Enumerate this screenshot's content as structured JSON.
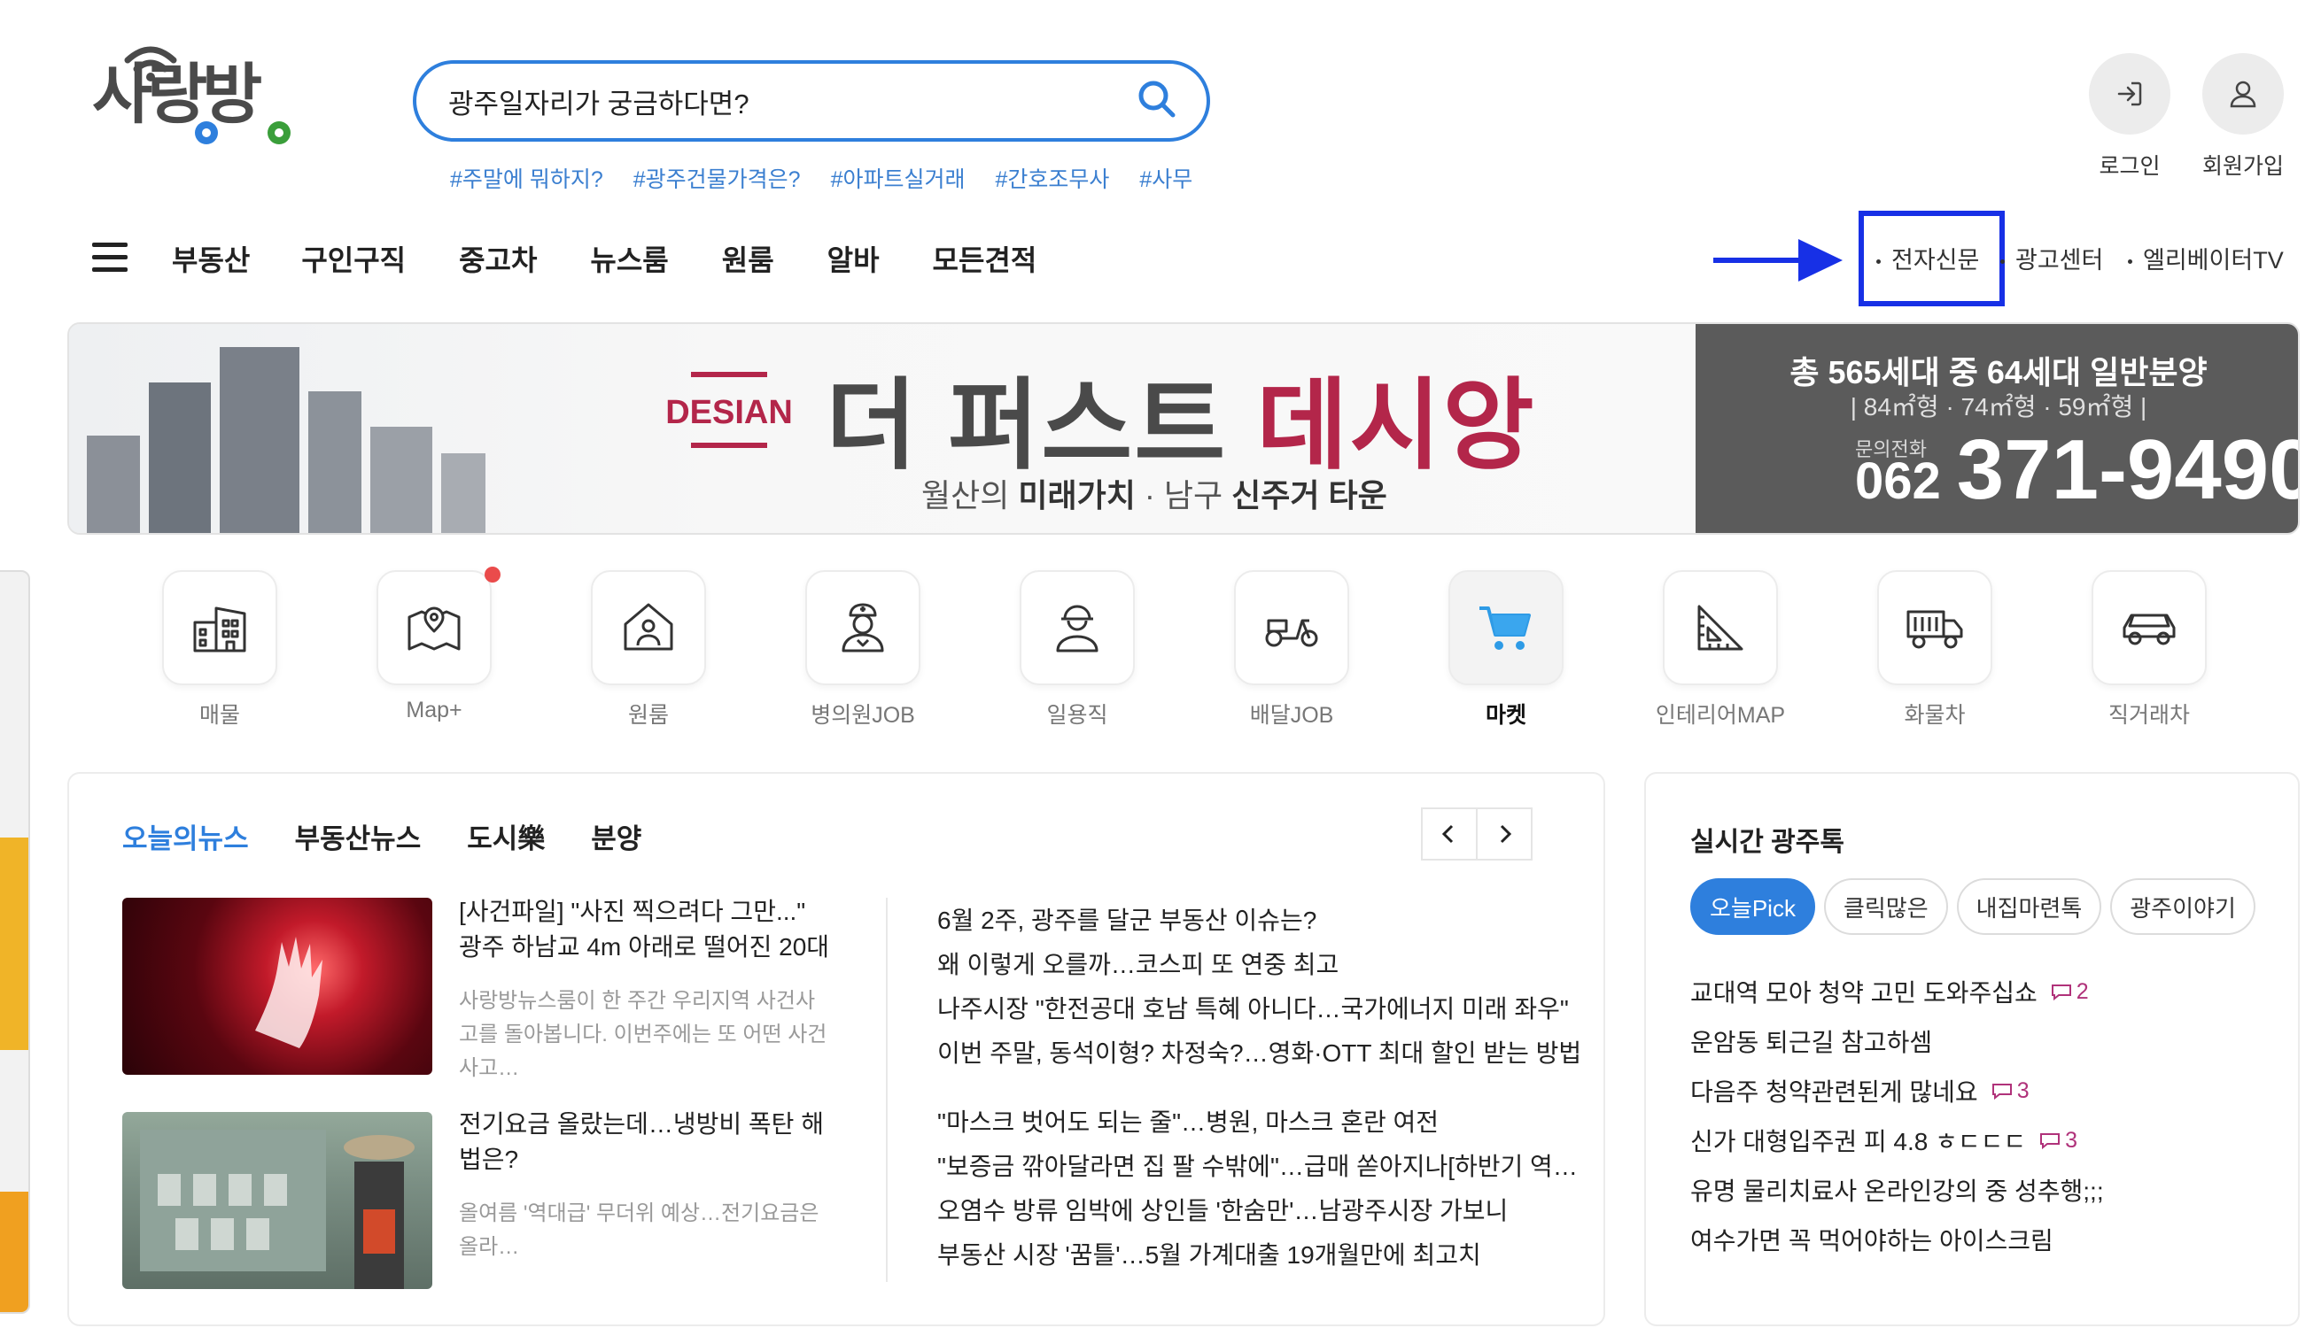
{
  "brand": {
    "logo_text": "사랑방"
  },
  "search": {
    "placeholder": "광주일자리가 궁금하다면?"
  },
  "hashtags": [
    "#주말에 뭐하지?",
    "#광주건물가격은?",
    "#아파트실거래",
    "#간호조무사",
    "#사무"
  ],
  "account": {
    "login": "로그인",
    "signup": "회원가입"
  },
  "nav": {
    "items": [
      "부동산",
      "구인구직",
      "중고차",
      "뉴스룸",
      "원룸",
      "알바",
      "모든견적"
    ],
    "utility": [
      "전자신문",
      "광고센터",
      "엘리베이터TV"
    ]
  },
  "banner": {
    "brand": "DESIAN",
    "headline_dark": "더 퍼스트 ",
    "headline_red": "데시앙",
    "sub_light1": "월산의 ",
    "sub_bold1": "미래가치",
    "sub_light2": " · 남구 ",
    "sub_bold2": "신주거 타운",
    "units": "총 565세대 중 64세대 일반분양",
    "sizes": "| 84㎡형 · 74㎡형 · 59㎡형 |",
    "inquiry_label": "문의전화",
    "phone_prefix": "062",
    "phone_number": "371-9490"
  },
  "quick_menu": [
    {
      "label": "매물",
      "icon": "building-icon"
    },
    {
      "label": "Map+",
      "icon": "map-pin-icon",
      "badge": true
    },
    {
      "label": "원룸",
      "icon": "house-user-icon"
    },
    {
      "label": "병의원JOB",
      "icon": "nurse-icon"
    },
    {
      "label": "일용직",
      "icon": "worker-icon"
    },
    {
      "label": "배달JOB",
      "icon": "scooter-icon"
    },
    {
      "label": "마켓",
      "icon": "cart-icon",
      "active": true
    },
    {
      "label": "인테리어MAP",
      "icon": "ruler-triangle-icon"
    },
    {
      "label": "화물차",
      "icon": "truck-icon"
    },
    {
      "label": "직거래차",
      "icon": "car-icon"
    }
  ],
  "news": {
    "tabs": [
      "오늘의뉴스",
      "부동산뉴스",
      "도시樂",
      "분양"
    ],
    "stories": [
      {
        "title": "[사건파일] \"사진 찍으려다 그만...\" 광주 하남교 4m 아래로 떨어진 20대",
        "desc": "사랑방뉴스룸이 한 주간 우리지역 사건사고를 돌아봅니다. 이번주에는 또 어떤 사건사고…"
      },
      {
        "title": "전기요금 올랐는데…냉방비 폭탄 해법은?",
        "desc": "올여름 '역대급' 무더위 예상…전기요금은 올라…"
      }
    ],
    "headlines_group1": [
      "6월 2주, 광주를 달군 부동산 이슈는?",
      "왜 이렇게 오를까…코스피 또 연중 최고",
      "나주시장 \"한전공대 호남 특혜 아니다…국가에너지 미래 좌우\"",
      "이번 주말, 동석이형? 차정숙?…영화·OTT 최대 할인 받는 방법"
    ],
    "headlines_group2": [
      "\"마스크 벗어도 되는 줄\"…병원, 마스크 혼란 여전",
      "\"보증금 깎아달라면 집 팔 수밖에\"…급매 쏟아지나[하반기 역…",
      "오염수 방류 임박에 상인들 '한숨만'…남광주시장 가보니",
      "부동산 시장 '꿈틀'…5월 가계대출 19개월만에 최고치"
    ]
  },
  "talk": {
    "title": "실시간 광주톡",
    "chips": [
      "오늘Pick",
      "클릭많은",
      "내집마련톡",
      "광주이야기"
    ],
    "items": [
      {
        "text": "교대역 모아 청약 고민 도와주십쇼",
        "comments": "2"
      },
      {
        "text": "운암동 퇴근길 참고하셈",
        "comments": ""
      },
      {
        "text": "다음주 청약관련된게 많네요",
        "comments": "3"
      },
      {
        "text": "신가 대형입주권 피 4.8 ㅎㄷㄷㄷ",
        "comments": "3"
      },
      {
        "text": "유명 물리치료사 온라인강의 중 성추행;;;",
        "comments": ""
      },
      {
        "text": "여수가면 꼭 먹어야하는 아이스크림",
        "comments": ""
      }
    ]
  },
  "colors": {
    "accent": "#2e7fdd",
    "highlight_box": "#1730e6",
    "banner_red": "#b3264a",
    "comment": "#b0327a"
  }
}
